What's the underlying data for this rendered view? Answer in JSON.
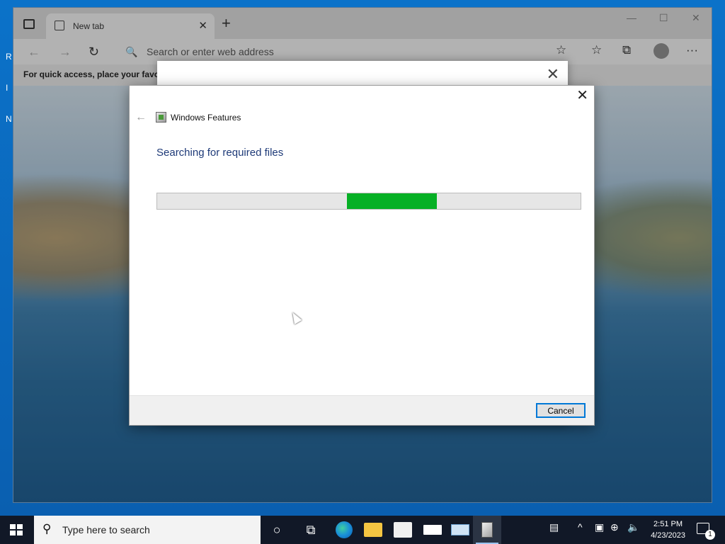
{
  "desktop": {
    "letters": "R\nI\nN"
  },
  "browser": {
    "tab_title": "New tab",
    "tab_close": "✕",
    "new_tab": "+",
    "window_controls": [
      "—",
      "☐",
      "✕"
    ],
    "address_placeholder": "Search or enter web address",
    "favorites_hint": "For quick access, place your favorit",
    "icons": {
      "back": "←",
      "forward": "→",
      "refresh": "↻",
      "search": "🔍",
      "add_favorite": "☆",
      "favorites": "☆",
      "collections": "⧉",
      "more": "···"
    }
  },
  "background_dialog": {
    "close": "✕"
  },
  "dialog": {
    "app_title": "Windows Features",
    "heading": "Searching for required files",
    "cancel_label": "Cancel",
    "close_glyph": "✕",
    "back_glyph": "←",
    "progress": {
      "indeterminate": true,
      "chunk_start_fraction": 0.448,
      "chunk_width_fraction": 0.212,
      "color": "#06b025"
    }
  },
  "taskbar": {
    "search_placeholder": "Type here to search",
    "search_glyph": "⚲",
    "cortana_glyph": "○",
    "task_view_glyph": "⧉",
    "tray_icons": [
      "▤",
      "^",
      "▣",
      "⊕",
      "🔈"
    ],
    "time": "2:51 PM",
    "date": "4/23/2023",
    "notification_count": "1"
  }
}
